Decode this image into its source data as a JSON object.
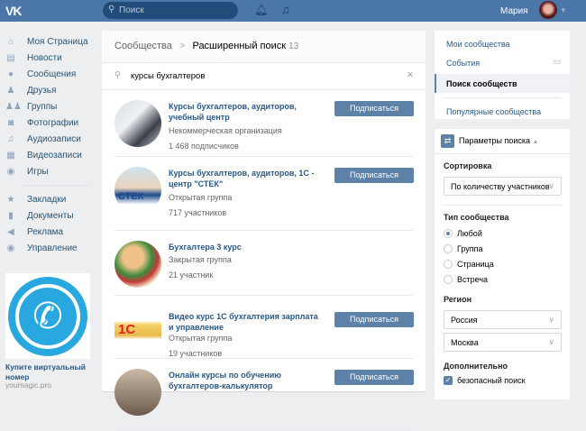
{
  "header": {
    "logo": "VK",
    "search_placeholder": "Поиск",
    "user_name": "Мария"
  },
  "sidebar": {
    "items": [
      {
        "label": "Моя Страница",
        "icon": "home-icon",
        "glyph": "⌂"
      },
      {
        "label": "Новости",
        "icon": "news-icon",
        "glyph": "▤"
      },
      {
        "label": "Сообщения",
        "icon": "messages-icon",
        "glyph": "●"
      },
      {
        "label": "Друзья",
        "icon": "friends-icon",
        "glyph": "♟"
      },
      {
        "label": "Группы",
        "icon": "groups-icon",
        "glyph": "♟♟"
      },
      {
        "label": "Фотографии",
        "icon": "camera-icon",
        "glyph": "◙"
      },
      {
        "label": "Аудиозаписи",
        "icon": "music-icon",
        "glyph": "♫"
      },
      {
        "label": "Видеозаписи",
        "icon": "video-icon",
        "glyph": "▦"
      },
      {
        "label": "Игры",
        "icon": "games-icon",
        "glyph": "◉"
      }
    ],
    "items2": [
      {
        "label": "Закладки",
        "icon": "star-icon",
        "glyph": "★"
      },
      {
        "label": "Документы",
        "icon": "document-icon",
        "glyph": "▮"
      },
      {
        "label": "Реклама",
        "icon": "megaphone-icon",
        "glyph": "◀"
      },
      {
        "label": "Управление",
        "icon": "gamepad-icon",
        "glyph": "◉"
      }
    ],
    "ad": {
      "title": "Купите виртуальный номер",
      "url": "youmagic.pro"
    }
  },
  "main": {
    "breadcrumb_root": "Сообщества",
    "breadcrumb_sep": ">",
    "title": "Расширенный поиск",
    "count": "13",
    "query": "курсы бухгалтеров",
    "subscribe": "Подписаться",
    "results": [
      {
        "name": "Курсы бухгалтеров, аудиторов, учебный центр",
        "type": "Некоммерческая организация",
        "members": "1 468 подписчиков",
        "button": true
      },
      {
        "name": "Курсы бухгалтеров, аудиторов, 1С - центр \"СТЕК\"",
        "type": "Открытая группа",
        "members": "717 участников",
        "button": true,
        "logo_text": "СТЕК"
      },
      {
        "name": "Бухгалтера 3 курс",
        "type": "Закрытая группа",
        "members": "21 участник",
        "button": false
      },
      {
        "name": "Видео курс 1С бухгалтерия зарплата и управление",
        "type": "Открытая группа",
        "members": "19 участников",
        "button": true,
        "logo_text": "1С"
      },
      {
        "name": "Онлайн курсы по обучению бухгалтеров-калькулятор",
        "type": "",
        "members": "",
        "button": true
      }
    ]
  },
  "right": {
    "menu": [
      "Мои сообщества",
      "События",
      "Поиск сообществ",
      "Популярные сообщества"
    ],
    "params_title": "Параметры поиска",
    "sort_label": "Сортировка",
    "sort_value": "По количеству участников",
    "type_label": "Тип сообщества",
    "types": [
      "Любой",
      "Группа",
      "Страница",
      "Встреча"
    ],
    "type_selected": 0,
    "region_label": "Регион",
    "country": "Россия",
    "city": "Москва",
    "extra_label": "Дополнительно",
    "safe_search": "безопасный поиск",
    "safe_search_checked": true
  },
  "colors": {
    "header": "#4a76a8",
    "button": "#5e81a8",
    "link": "#2a5885"
  }
}
